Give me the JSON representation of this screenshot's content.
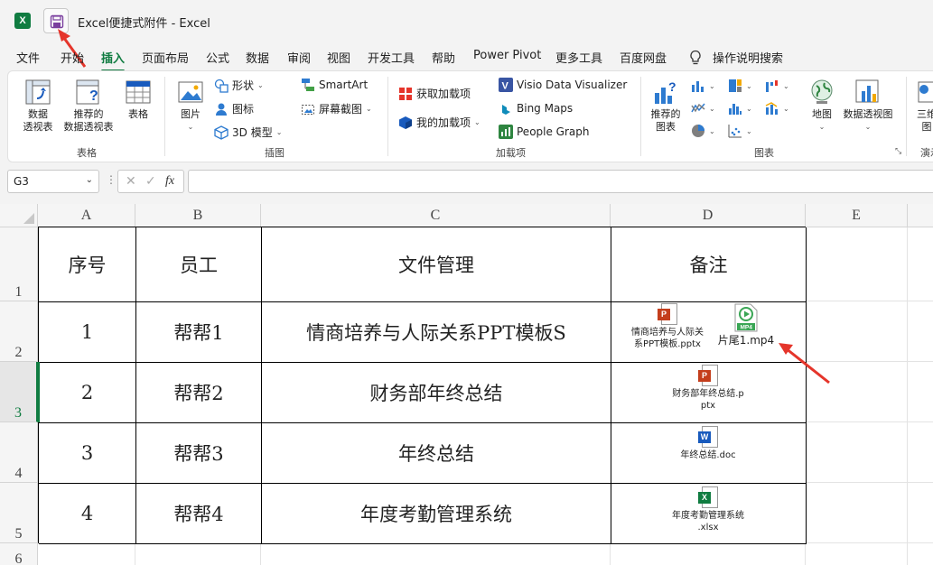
{
  "window": {
    "title": "Excel便捷式附件  -  Excel",
    "app_logo": "X"
  },
  "menu": {
    "tabs": [
      "文件",
      "开始",
      "插入",
      "页面布局",
      "公式",
      "数据",
      "审阅",
      "视图",
      "开发工具",
      "帮助",
      "Power Pivot",
      "更多工具",
      "百度网盘"
    ],
    "active": "插入",
    "search": "操作说明搜索"
  },
  "ribbon": {
    "tables": {
      "label": "表格",
      "pivot": "数据\n透视表",
      "recommended_pivot": "推荐的\n数据透视表",
      "table": "表格"
    },
    "illustrations": {
      "label": "插图",
      "pictures": "图片",
      "shapes": "形状",
      "icons": "图标",
      "models3d": "3D 模型",
      "smartart": "SmartArt",
      "screenshot": "屏幕截图"
    },
    "addins": {
      "label": "加载项",
      "get": "获取加载项",
      "my": "我的加载项",
      "visio": "Visio Data Visualizer",
      "bing": "Bing Maps",
      "people": "People Graph"
    },
    "charts": {
      "label": "图表",
      "recommended": "推荐的\n图表",
      "maps": "地图",
      "pivot_chart": "数据透视图"
    },
    "tours": {
      "label": "演示",
      "map3d": "三维\n图"
    }
  },
  "formula_bar": {
    "name_box": "G3",
    "dots": "⋮",
    "cancel": "✕",
    "enter": "✓",
    "fx": "fx",
    "value": ""
  },
  "grid": {
    "columns": [
      "A",
      "B",
      "C",
      "D",
      "E"
    ],
    "rows": [
      "1",
      "2",
      "3",
      "4",
      "5",
      "6"
    ],
    "selected_row": "3",
    "headers": [
      "序号",
      "员工",
      "文件管理",
      "备注"
    ],
    "data": [
      {
        "no": "1",
        "staff": "帮帮1",
        "file": "情商培养与人际关系PPT模板S"
      },
      {
        "no": "2",
        "staff": "帮帮2",
        "file": "财务部年终总结"
      },
      {
        "no": "3",
        "staff": "帮帮3",
        "file": "年终总结"
      },
      {
        "no": "4",
        "staff": "帮帮4",
        "file": "年度考勤管理系统"
      }
    ],
    "attachments": {
      "r2_ppt": {
        "line1": "情商培养与人际关",
        "line2": "系PPT模板.pptx",
        "badge": "P"
      },
      "r2_mp4": {
        "line1": "片尾1.mp4",
        "badge": "MP4"
      },
      "r3_ppt": {
        "line1": "财务部年终总结.p",
        "line2": "ptx",
        "badge": "P"
      },
      "r4_doc": {
        "line1": "年终总结.doc",
        "badge": "W"
      },
      "r5_xlsx": {
        "line1": "年度考勤管理系统",
        "line2": ".xlsx",
        "badge": "X"
      }
    }
  },
  "colors": {
    "excel_green": "#107c41",
    "ppt_red": "#c43e1c",
    "word_blue": "#185abd",
    "arrow_red": "#e5352b"
  }
}
